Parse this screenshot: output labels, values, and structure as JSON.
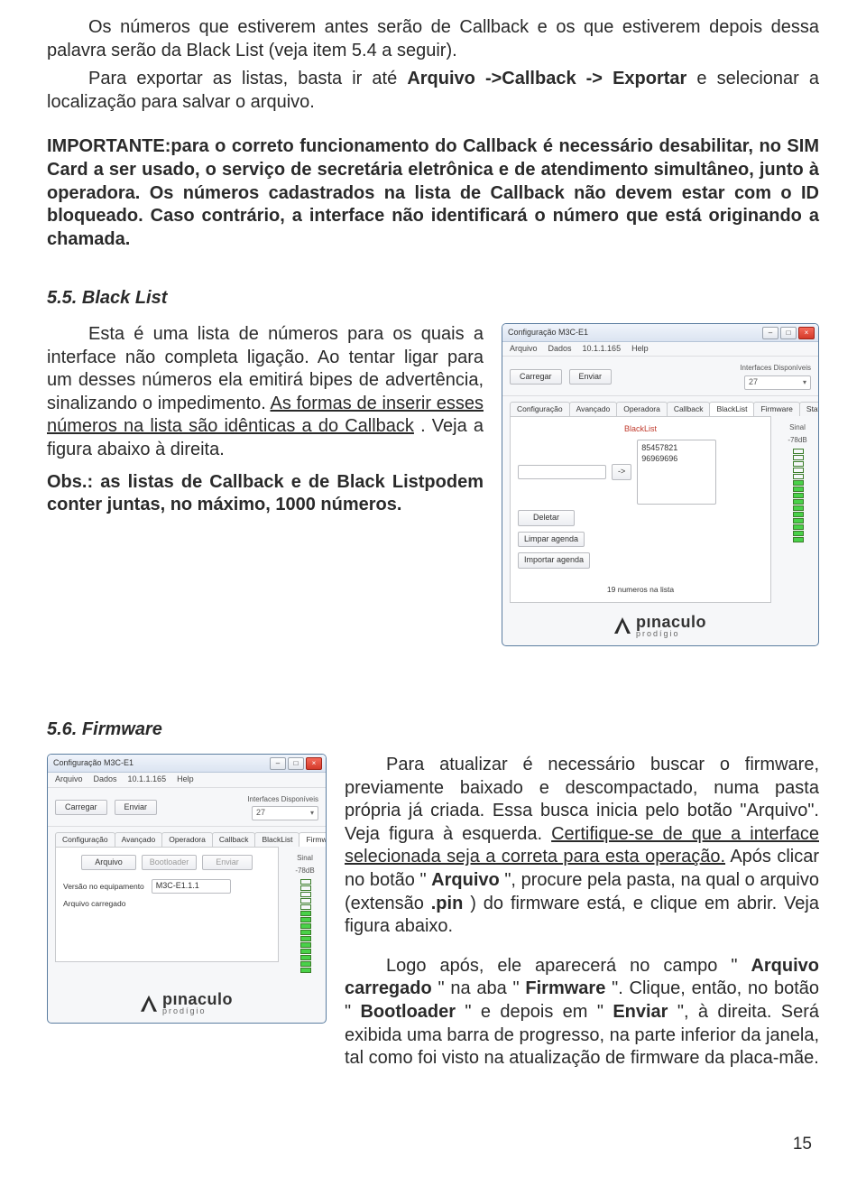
{
  "p1": "Os números que estiverem antes serão de Callback e os que estiverem depois dessa palavra serão da Black List (veja item 5.4 a seguir).",
  "p2_pre": "Para exportar as listas, basta ir até ",
  "p2_path": "Arquivo ->Callback -> Exportar",
  "p2_post": "e selecionar a localização para salvar o arquivo.",
  "important": "IMPORTANTE:para o correto funcionamento do Callback é necessário desabilitar, no SIM Card a ser usado, o serviço de secretária eletrônica e de atendimento simultâneo, junto à operadora. Os números cadastrados na lista de Callback não devem estar com o ID bloqueado. Caso contrário, a interface não identificará o número que está originando a chamada.",
  "s55_title": "5.5. Black List",
  "s55_p1a": "Esta é uma lista de números para os quais a interface não completa ligação. Ao tentar ligar para um desses números ela emitirá bipes de advertência, sinalizando o impedimento. ",
  "s55_p1b": "As formas de inserir esses números na lista são idênticas a do Callback",
  "s55_p1c": ". Veja a figura abaixo à direita.",
  "s55_obs": "Obs.: as listas de Callback e de Black Listpodem conter juntas, no máximo, 1000 números.",
  "s56_title": "5.6. Firmware",
  "s56_p1a": "Para atualizar é necessário buscar o firmware, previamente baixado e descompactado, numa pasta própria já criada. Essa busca inicia pelo botão \"Arquivo\". Veja figura à esquerda. ",
  "s56_p1b": "Certifique-se de que a interface selecionada seja a correta para esta operação.",
  "s56_p1c": "Após clicar no botão \"",
  "s56_p1d": "Arquivo",
  "s56_p1e": "\", procure pela pasta, na qual o arquivo (extensão ",
  "s56_p1f": ".pin",
  "s56_p1g": ") do firmware está, e clique em abrir. Veja figura abaixo.",
  "s56_p2a": "Logo após, ele aparecerá no campo \"",
  "s56_p2b": "Arquivo carregado",
  "s56_p2c": "\" na aba \"",
  "s56_p2d": "Firmware",
  "s56_p2e": "\". Clique, então, no botão \"",
  "s56_p2f": "Bootloader",
  "s56_p2g": "\" e depois em \"",
  "s56_p2h": "Enviar",
  "s56_p2i": "\", à direita. Será exibida uma barra de progresso, na parte inferior da janela, tal como foi visto na atualização de firmware da placa-mãe.",
  "page_number": "15",
  "app": {
    "title": "Configuração M3C-E1",
    "menu": {
      "arquivo": "Arquivo",
      "dados": "Dados",
      "ip": "10.1.1.165",
      "help": "Help"
    },
    "toolbar": {
      "carregar": "Carregar",
      "enviar": "Enviar"
    },
    "intf": {
      "label": "Interfaces Disponíveis",
      "value": "27"
    },
    "tabs": {
      "conf": "Configuração",
      "av": "Avançado",
      "op": "Operadora",
      "cb": "Callback",
      "bl": "BlackList",
      "fw": "Firmware",
      "st": "Status"
    },
    "signal": {
      "label": "Sinal",
      "value": "-78dB"
    },
    "brand": {
      "name": "pınaculo",
      "sub": "prodígio"
    }
  },
  "blacklist": {
    "title": "BlackList",
    "arrow": "->",
    "phones": [
      "85457821",
      "96969696"
    ],
    "btn_del": "Deletar",
    "btn_limpar": "Limpar agenda",
    "btn_import": "Importar agenda",
    "status": "19 numeros na lista"
  },
  "firmware": {
    "btn_arquivo": "Arquivo",
    "btn_boot": "Bootloader",
    "btn_enviar": "Enviar",
    "lbl_ver": "Versão no equipamento",
    "ver_val": "M3C-E1.1.1",
    "lbl_file": "Arquivo carregado"
  }
}
